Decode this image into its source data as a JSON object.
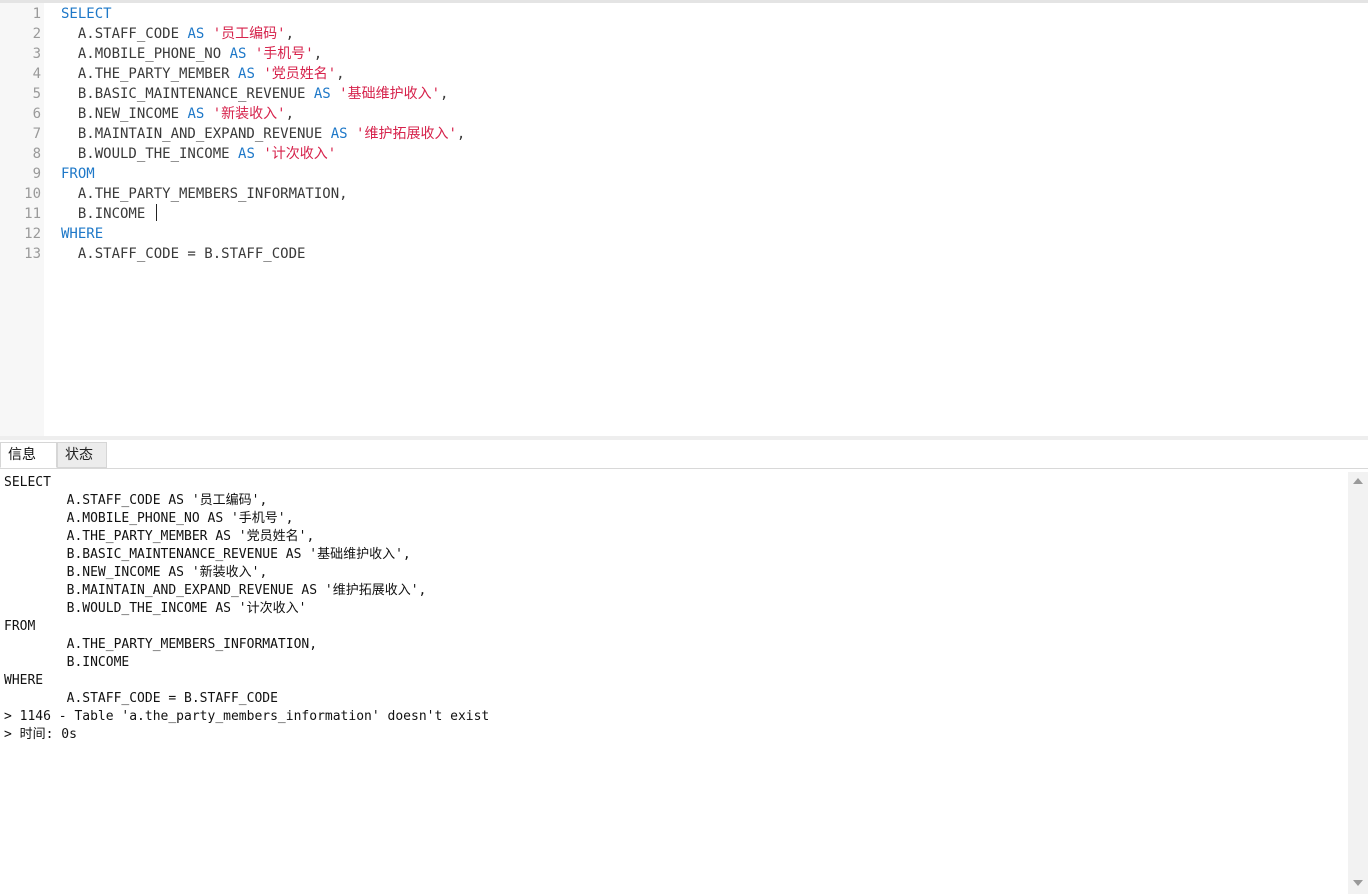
{
  "editor": {
    "line_numbers": [
      "1",
      "2",
      "3",
      "4",
      "5",
      "6",
      "7",
      "8",
      "9",
      "10",
      "11",
      "12",
      "13"
    ],
    "lines": [
      [
        {
          "t": "SELECT",
          "k": "kw"
        }
      ],
      [
        {
          "t": "  A.STAFF_CODE "
        },
        {
          "t": "AS",
          "k": "kw"
        },
        {
          "t": " "
        },
        {
          "t": "'员工编码'",
          "k": "str"
        },
        {
          "t": ","
        }
      ],
      [
        {
          "t": "  A.MOBILE_PHONE_NO "
        },
        {
          "t": "AS",
          "k": "kw"
        },
        {
          "t": " "
        },
        {
          "t": "'手机号'",
          "k": "str"
        },
        {
          "t": ","
        }
      ],
      [
        {
          "t": "  A.THE_PARTY_MEMBER "
        },
        {
          "t": "AS",
          "k": "kw"
        },
        {
          "t": " "
        },
        {
          "t": "'党员姓名'",
          "k": "str"
        },
        {
          "t": ","
        }
      ],
      [
        {
          "t": "  B.BASIC_MAINTENANCE_REVENUE "
        },
        {
          "t": "AS",
          "k": "kw"
        },
        {
          "t": " "
        },
        {
          "t": "'基础维护收入'",
          "k": "str"
        },
        {
          "t": ","
        }
      ],
      [
        {
          "t": "  B.NEW_INCOME "
        },
        {
          "t": "AS",
          "k": "kw"
        },
        {
          "t": " "
        },
        {
          "t": "'新装收入'",
          "k": "str"
        },
        {
          "t": ","
        }
      ],
      [
        {
          "t": "  B.MAINTAIN_AND_EXPAND_REVENUE "
        },
        {
          "t": "AS",
          "k": "kw"
        },
        {
          "t": " "
        },
        {
          "t": "'维护拓展收入'",
          "k": "str"
        },
        {
          "t": ","
        }
      ],
      [
        {
          "t": "  B.WOULD_THE_INCOME "
        },
        {
          "t": "AS",
          "k": "kw"
        },
        {
          "t": " "
        },
        {
          "t": "'计次收入'",
          "k": "str"
        }
      ],
      [
        {
          "t": "FROM",
          "k": "kw"
        }
      ],
      [
        {
          "t": "  A.THE_PARTY_MEMBERS_INFORMATION,"
        }
      ],
      [
        {
          "t": "  B.INCOME "
        }
      ],
      [
        {
          "t": "WHERE",
          "k": "kw"
        }
      ],
      [
        {
          "t": "  A.STAFF_CODE = B.STAFF_CODE"
        }
      ]
    ]
  },
  "tabs": [
    {
      "label": "信息",
      "active": true
    },
    {
      "label": "状态",
      "active": false
    }
  ],
  "output": {
    "lines": [
      "SELECT",
      "        A.STAFF_CODE AS '员工编码',",
      "        A.MOBILE_PHONE_NO AS '手机号',",
      "        A.THE_PARTY_MEMBER AS '党员姓名',",
      "        B.BASIC_MAINTENANCE_REVENUE AS '基础维护收入',",
      "        B.NEW_INCOME AS '新装收入',",
      "        B.MAINTAIN_AND_EXPAND_REVENUE AS '维护拓展收入',",
      "        B.WOULD_THE_INCOME AS '计次收入'",
      "FROM",
      "        A.THE_PARTY_MEMBERS_INFORMATION,",
      "        B.INCOME",
      "WHERE",
      "        A.STAFF_CODE = B.STAFF_CODE",
      "> 1146 - Table 'a.the_party_members_information' doesn't exist",
      "> 时间: 0s"
    ]
  },
  "colors": {
    "keyword": "#1e78c8",
    "string": "#d6224b",
    "text": "#3a3a3a",
    "line_number": "#9a9a9a",
    "gutter_bg": "#f7f7f7"
  },
  "icons": {
    "scroll_up": "triangle-up",
    "scroll_down": "triangle-down"
  }
}
